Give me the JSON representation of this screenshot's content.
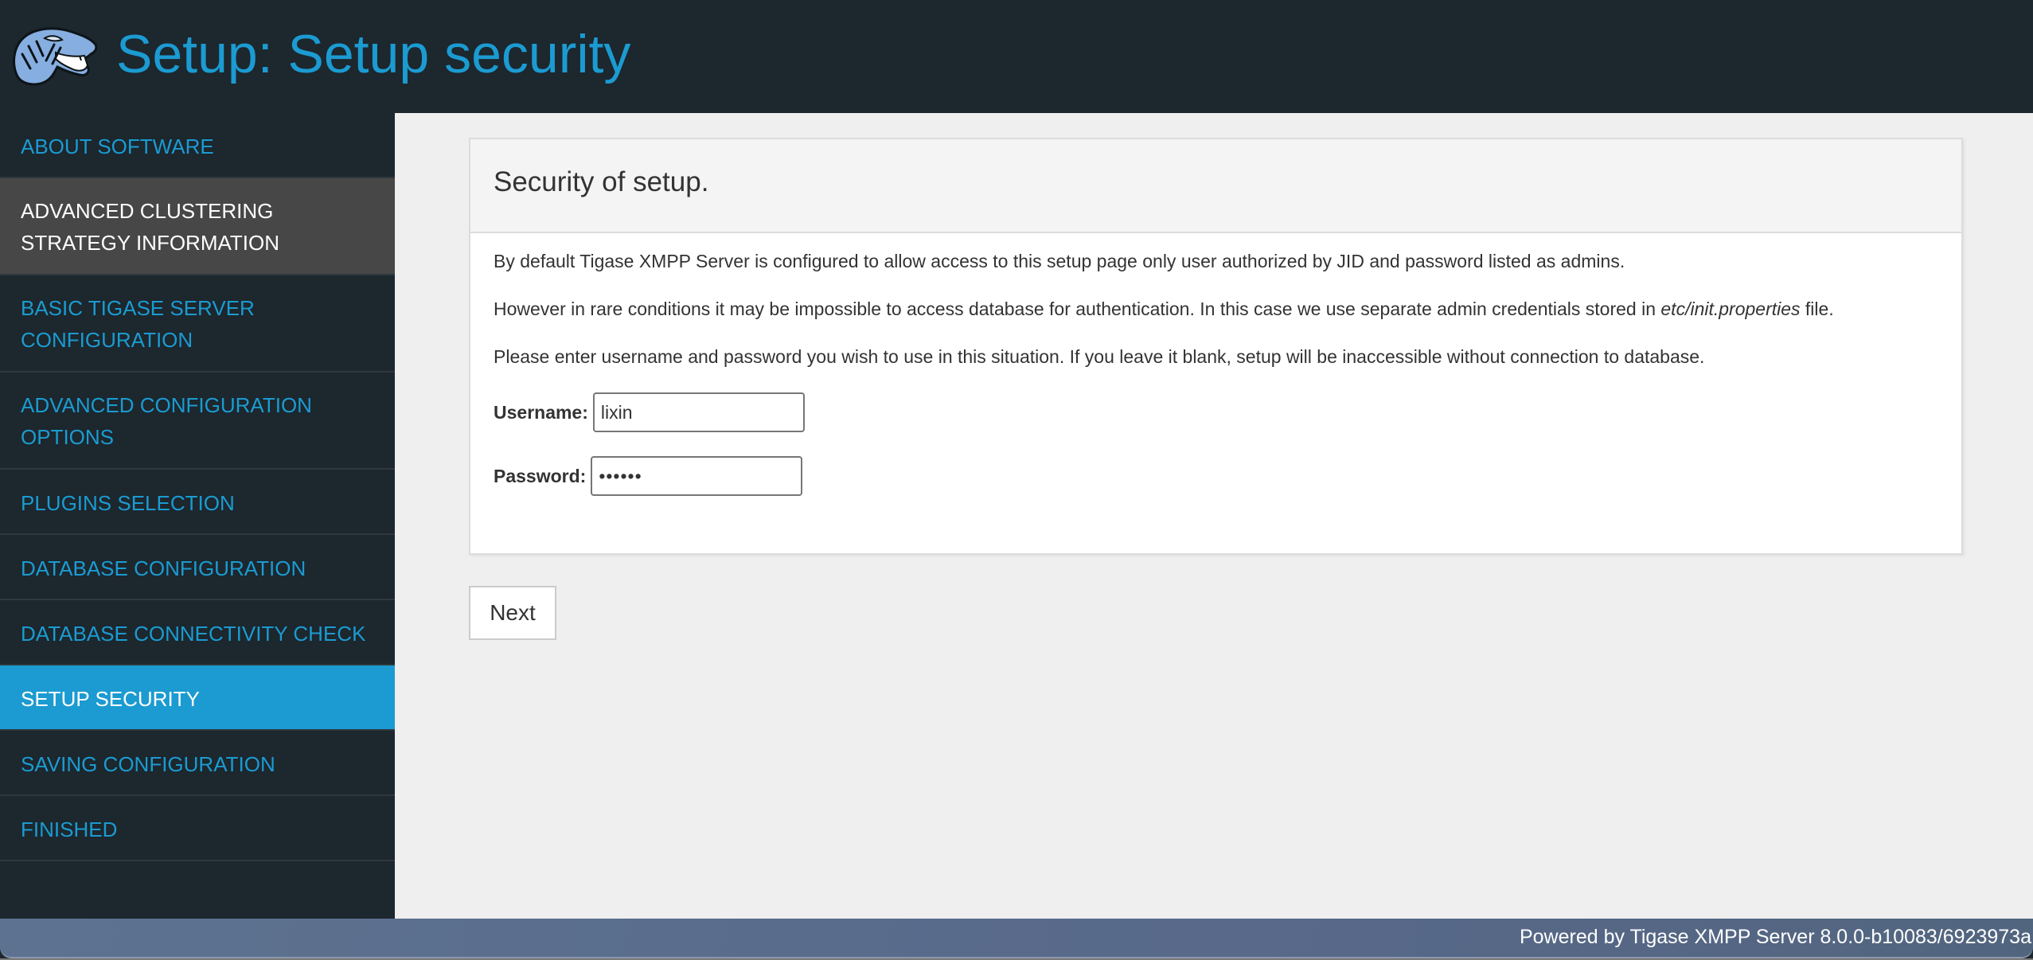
{
  "header": {
    "logo_alt": "tiger-logo",
    "title": "Setup: Setup security"
  },
  "sidebar": {
    "items": [
      {
        "label": "ABOUT SOFTWARE",
        "state": "normal"
      },
      {
        "label": "ADVANCED CLUSTERING STRATEGY INFORMATION",
        "state": "hover"
      },
      {
        "label": "BASIC TIGASE SERVER CONFIGURATION",
        "state": "normal"
      },
      {
        "label": "ADVANCED CONFIGURATION OPTIONS",
        "state": "normal"
      },
      {
        "label": "PLUGINS SELECTION",
        "state": "normal"
      },
      {
        "label": "DATABASE CONFIGURATION",
        "state": "normal"
      },
      {
        "label": "DATABASE CONNECTIVITY CHECK",
        "state": "normal"
      },
      {
        "label": "SETUP SECURITY",
        "state": "active"
      },
      {
        "label": "SAVING CONFIGURATION",
        "state": "normal"
      },
      {
        "label": "FINISHED",
        "state": "normal"
      }
    ]
  },
  "panel": {
    "heading": "Security of setup.",
    "paragraph1": "By default Tigase XMPP Server is configured to allow access to this setup page only user authorized by JID and password listed as admins.",
    "paragraph2_before": "However in rare conditions it may be impossible to access database for authentication. In this case we use separate admin credentials stored in ",
    "paragraph2_em": "etc/init.properties",
    "paragraph2_after": " file.",
    "paragraph3": "Please enter username and password you wish to use in this situation. If you leave it blank, setup will be inaccessible without connection to database.",
    "username_label": "Username:",
    "username_value": "lixin",
    "password_label": "Password:",
    "password_value": "••••••"
  },
  "actions": {
    "next_label": "Next"
  },
  "footer": {
    "text": "Powered by Tigase XMPP Server 8.0.0-b10083/6923973a"
  },
  "colors": {
    "accent": "#1b9bd1",
    "header_bg": "#1c272e",
    "hover_bg": "#474747",
    "content_bg": "#efefef"
  }
}
